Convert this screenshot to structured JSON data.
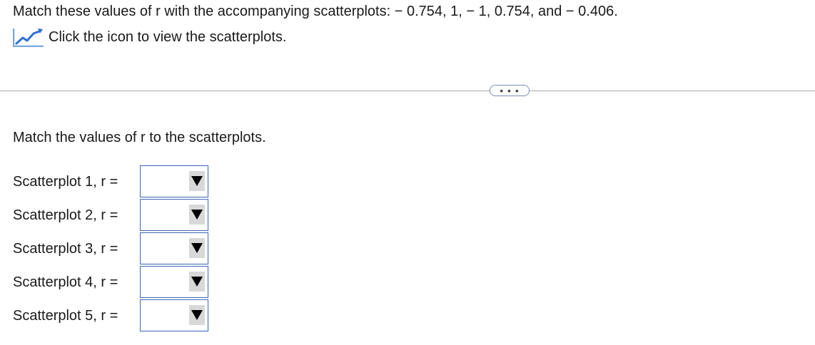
{
  "question": {
    "text": "Match these values of r with the accompanying scatterplots:  − 0.754,  1,   − 1,  0.754,  and   − 0.406."
  },
  "icon_link": {
    "icon": "chart-line-icon",
    "text": "Click the icon to view the scatterplots."
  },
  "more_button": {
    "label": "• • •"
  },
  "section": {
    "heading": "Match the values of r to the scatterplots."
  },
  "rows": [
    {
      "label": "Scatterplot 1, r =",
      "selected": ""
    },
    {
      "label": "Scatterplot 2, r =",
      "selected": ""
    },
    {
      "label": "Scatterplot 3, r =",
      "selected": ""
    },
    {
      "label": "Scatterplot 4, r =",
      "selected": ""
    },
    {
      "label": "Scatterplot 5, r =",
      "selected": ""
    }
  ],
  "colors": {
    "accent": "#3b66b5",
    "icon_line": "#2f6fd6",
    "divider": "#a8a8a8"
  }
}
